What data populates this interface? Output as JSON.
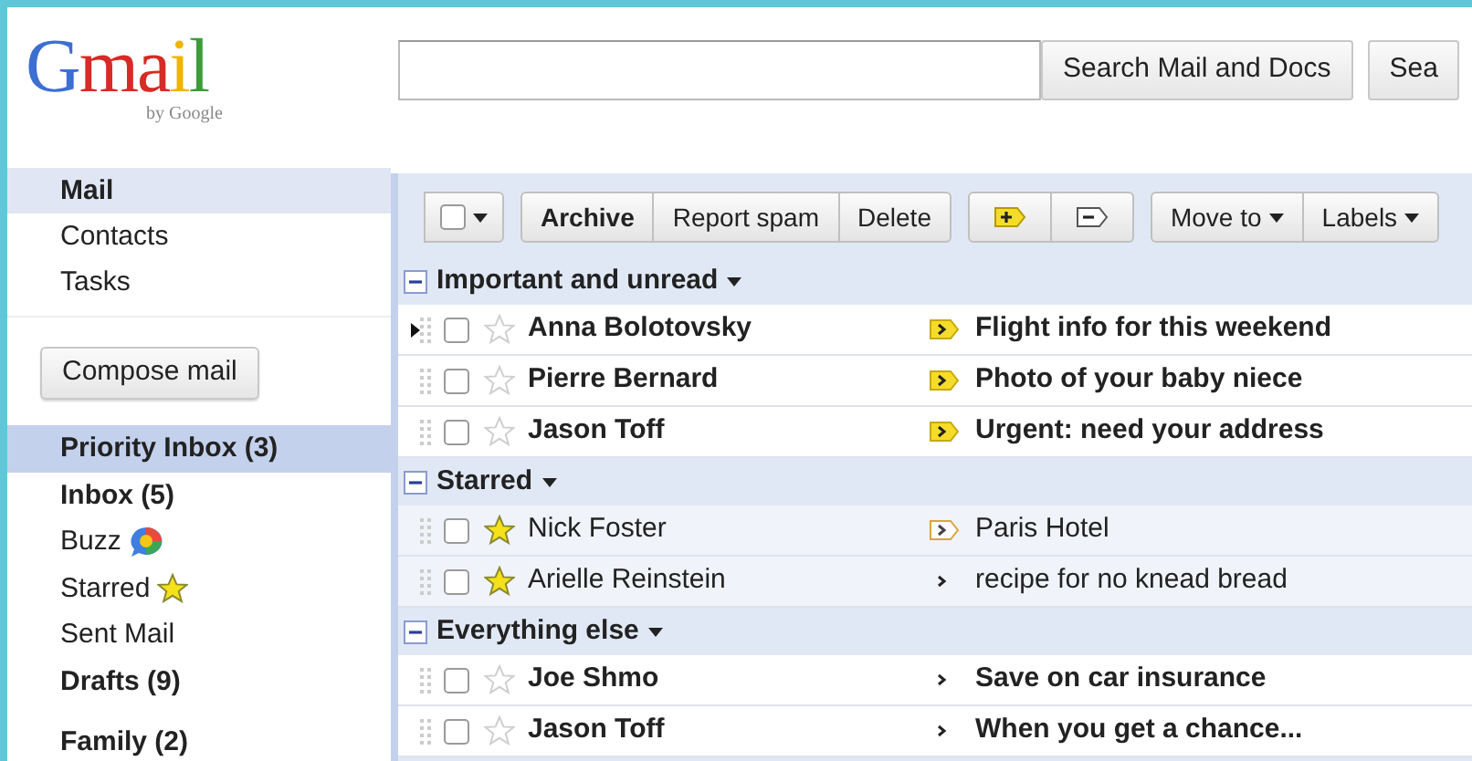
{
  "logo": {
    "text": "Gmail",
    "tagline": "by Google"
  },
  "search": {
    "buttons": [
      "Search Mail and Docs",
      "Sea"
    ]
  },
  "apps_nav": [
    {
      "label": "Mail",
      "selected": true
    },
    {
      "label": "Contacts",
      "selected": false
    },
    {
      "label": "Tasks",
      "selected": false
    }
  ],
  "compose_button": "Compose mail",
  "sidebar": {
    "items": [
      {
        "label": "Priority Inbox (3)",
        "selected": true,
        "bold": true,
        "kind": "plain"
      },
      {
        "label": "Inbox (5)",
        "selected": false,
        "bold": true,
        "kind": "plain"
      },
      {
        "label": "Buzz",
        "selected": false,
        "bold": false,
        "kind": "buzz"
      },
      {
        "label": "Starred",
        "selected": false,
        "bold": false,
        "kind": "starred"
      },
      {
        "label": "Sent Mail",
        "selected": false,
        "bold": false,
        "kind": "plain"
      },
      {
        "label": "Drafts (9)",
        "selected": false,
        "bold": true,
        "kind": "plain"
      },
      {
        "label": "Family (2)",
        "selected": false,
        "bold": true,
        "kind": "plain"
      }
    ]
  },
  "toolbar": {
    "groups": [
      [
        {
          "kind": "select"
        }
      ],
      [
        {
          "kind": "text",
          "label": "Archive",
          "bold": true
        },
        {
          "kind": "text",
          "label": "Report spam",
          "bold": false
        },
        {
          "kind": "text",
          "label": "Delete",
          "bold": false
        }
      ],
      [
        {
          "kind": "mark-important"
        },
        {
          "kind": "mark-unimportant"
        }
      ],
      [
        {
          "kind": "menu",
          "label": "Move to",
          "bold": false
        },
        {
          "kind": "menu",
          "label": "Labels",
          "bold": false
        }
      ]
    ]
  },
  "sections": [
    {
      "title": "Important and unread",
      "expanded": true,
      "rows": [
        {
          "sender": "Anna Bolotovsky",
          "subject": "Flight info for this weekend",
          "unread": true,
          "starred": false,
          "checked": false,
          "pointer": true,
          "important": true
        },
        {
          "sender": "Pierre Bernard",
          "subject": "Photo of your baby niece",
          "unread": true,
          "starred": false,
          "checked": false,
          "pointer": false,
          "important": true
        },
        {
          "sender": "Jason Toff",
          "subject": "Urgent: need your address",
          "unread": true,
          "starred": false,
          "checked": false,
          "pointer": false,
          "important": true
        }
      ]
    },
    {
      "title": "Starred",
      "expanded": true,
      "rows": [
        {
          "sender": "Nick Foster",
          "subject": "Paris Hotel",
          "unread": false,
          "starred": true,
          "checked": false,
          "pointer": false,
          "important": true
        },
        {
          "sender": "Arielle Reinstein",
          "subject": "recipe for no knead bread",
          "unread": false,
          "starred": true,
          "checked": false,
          "pointer": false,
          "important": false
        }
      ]
    },
    {
      "title": "Everything else",
      "expanded": true,
      "rows": [
        {
          "sender": "Joe Shmo",
          "subject": "Save on car insurance",
          "unread": true,
          "starred": false,
          "checked": false,
          "pointer": false,
          "important": false
        },
        {
          "sender": "Jason Toff",
          "subject": "When you get a chance...",
          "unread": true,
          "starred": false,
          "checked": false,
          "pointer": false,
          "important": false
        }
      ]
    }
  ]
}
